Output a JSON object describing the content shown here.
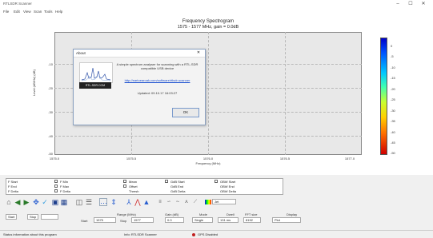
{
  "window": {
    "title": "RTLSDR Scanner",
    "min": "–",
    "max": "☐",
    "close": "✕"
  },
  "menu": [
    "File",
    "Edit",
    "View",
    "Scan",
    "Tools",
    "Help"
  ],
  "plot": {
    "title_line1": "Frequency Spectrogram",
    "title_line2": "1575 - 1577 MHz, gain = 0.0dB",
    "ylabel": "Level (dB/Hz) (dB)",
    "xlabel": "Frequency (MHz)",
    "yticks": [
      "-10",
      "-20",
      "-30",
      "-40",
      "-50"
    ],
    "xticks": [
      "1575.0",
      "1575.5",
      "1576.0",
      "1576.5",
      "1577.0"
    ],
    "colorbar_ticks": [
      "0",
      "-5",
      "-10",
      "-15",
      "-20",
      "-25",
      "-30",
      "-35",
      "-40",
      "-45",
      "-50"
    ]
  },
  "dialog": {
    "title": "About",
    "close": "✕",
    "logo_text": "RTL-SDR.COM",
    "description": "A simple spectrum analyser for scanning with a RTL-SDR compatible USB device",
    "link": "http://eartoearoak.com/software/rtlsdr-scanner",
    "updated": "Updated: 09.10.17 16:03:27",
    "ok": "OK"
  },
  "markers": {
    "col1": [
      "F Start",
      "F End",
      "F Delta"
    ],
    "col2": [
      "F Min",
      "F Max",
      "F Delta"
    ],
    "col3": [
      "Mean",
      "Offset",
      "Thresh"
    ],
    "col4": [
      "GdB Start",
      "GdB End",
      "GdB Delta"
    ],
    "col5": [
      "OBW Start",
      "OBW End",
      "OBW Delta"
    ]
  },
  "toolbar": {
    "icons": [
      "home-icon",
      "back-icon",
      "forward-icon",
      "pan-icon",
      "zoom-icon",
      "save-icon",
      "subplots-icon",
      "grid-icon",
      "marker-icon",
      "range-icon",
      "peak-icon",
      "line-icon",
      "mountain-icon",
      "cursor-icon",
      "avg-icon",
      "smooth-icon",
      "diff-icon",
      "delta-icon",
      "color-icon"
    ],
    "color_select": "Jet"
  },
  "settings": {
    "start_btn": "Start",
    "stop_btn": "Stop",
    "start_label": "Start",
    "start_value": "1575",
    "stop_label": "Stop",
    "stop_value": "1577",
    "range_label": "Range (MHz)",
    "gain_label": "Gain (dB)",
    "gain_value": "0.0",
    "mode_label": "Mode",
    "mode_value": "Single",
    "dwell_label": "Dwell",
    "dwell_value": "131 ms",
    "fft_label": "FFT size",
    "fft_value": "8192",
    "display_label": "Display",
    "display_value": "Plot"
  },
  "status": {
    "left": "Status information about this program",
    "middle": "Info: RTLSDR Scanner",
    "right": "GPS Disabled"
  }
}
